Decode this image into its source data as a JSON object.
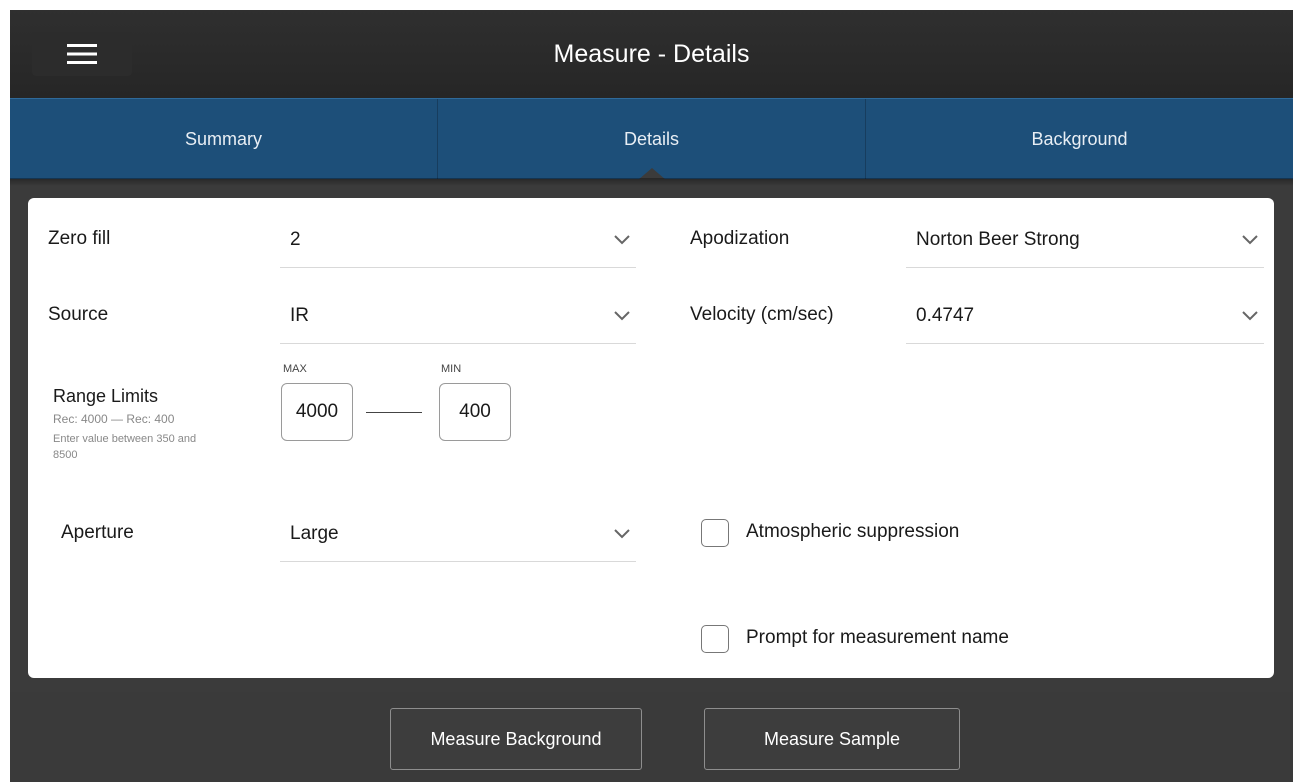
{
  "header": {
    "title": "Measure - Details",
    "menu_icon": "hamburger-menu-icon"
  },
  "tabs": [
    {
      "label": "Summary",
      "active": false
    },
    {
      "label": "Details",
      "active": true
    },
    {
      "label": "Background",
      "active": false
    }
  ],
  "form": {
    "zero_fill": {
      "label": "Zero fill",
      "value": "2"
    },
    "apodization": {
      "label": "Apodization",
      "value": "Norton Beer Strong"
    },
    "source": {
      "label": "Source",
      "value": "IR"
    },
    "velocity": {
      "label": "Velocity (cm/sec)",
      "value": "0.4747"
    },
    "range_limits": {
      "label": "Range Limits",
      "recommended": "Rec: 4000 — Rec: 400",
      "hint_line1": "Enter value between 350 and",
      "hint_line2": "8500",
      "max_label": "MAX",
      "max_value": "4000",
      "min_label": "MIN",
      "min_value": "400"
    },
    "aperture": {
      "label": "Aperture",
      "value": "Large"
    },
    "atmospheric_suppression": {
      "label": "Atmospheric suppression",
      "checked": false
    },
    "prompt_measurement_name": {
      "label": "Prompt for measurement name",
      "checked": false
    }
  },
  "footer": {
    "measure_background_label": "Measure Background",
    "measure_sample_label": "Measure Sample"
  },
  "colors": {
    "tab_bar": "#1d4f79",
    "title_bar": "#2a2a2a",
    "frame_bg": "#3b3b3b",
    "panel_bg": "#ffffff"
  }
}
